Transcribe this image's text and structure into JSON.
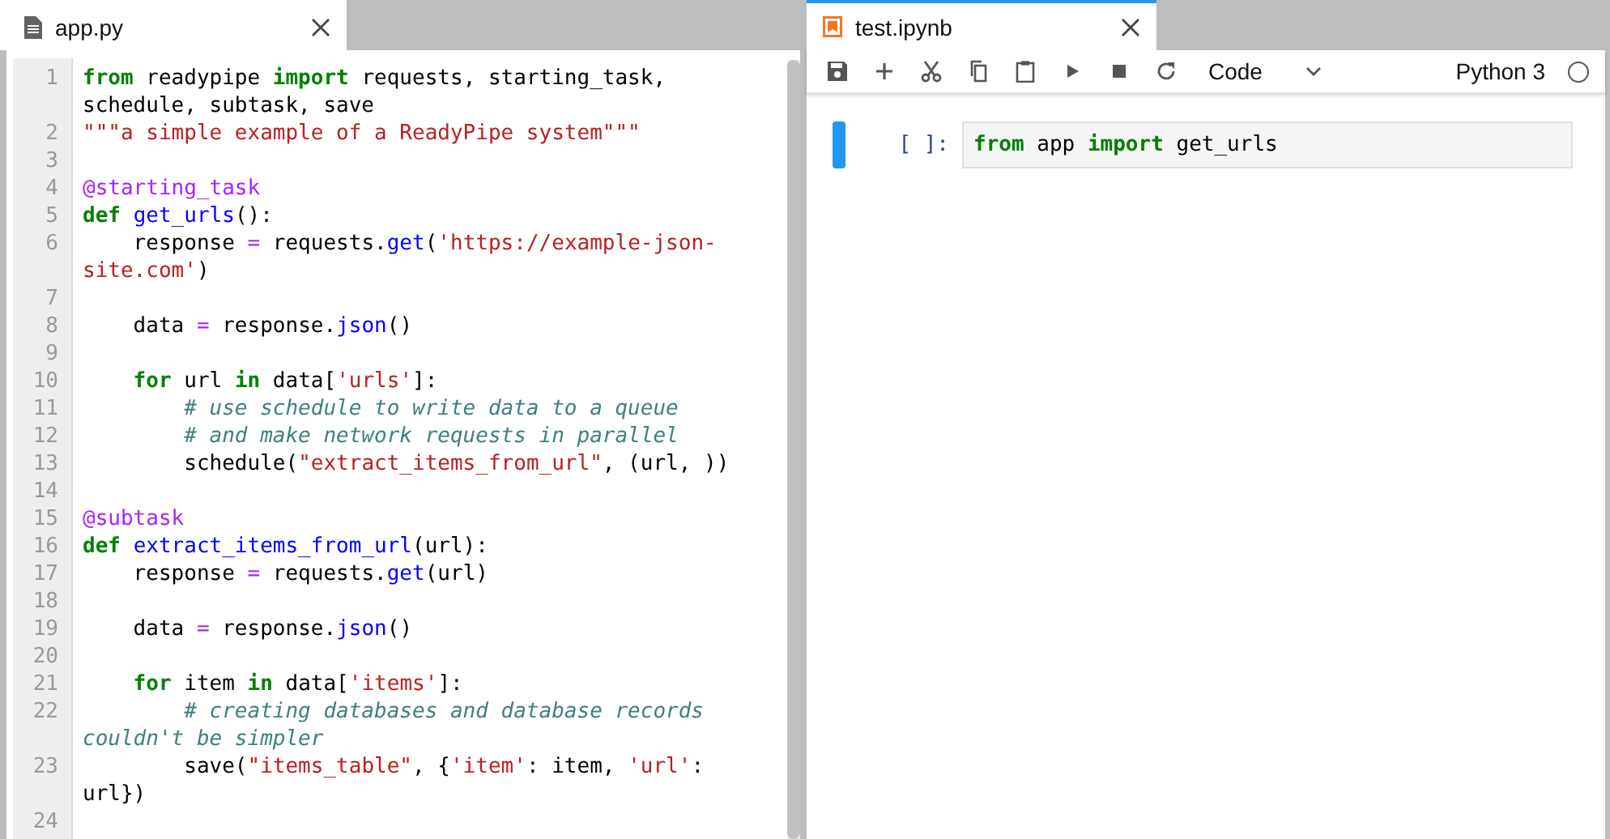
{
  "editor": {
    "tab": {
      "label": "app.py",
      "kind": "file"
    },
    "lines": [
      {
        "number": "1",
        "tokens": [
          {
            "kind": "kw",
            "text": "from"
          },
          {
            "kind": "plain",
            "text": " readypipe "
          },
          {
            "kind": "kw",
            "text": "import"
          },
          {
            "kind": "plain",
            "text": " requests, starting_task,"
          }
        ],
        "wrapped": [
          {
            "kind": "plain",
            "text": "schedule, subtask, save"
          }
        ]
      },
      {
        "number": "2",
        "tokens": [
          {
            "kind": "str",
            "text": "\"\"\"a simple example of a ReadyPipe system\"\"\""
          }
        ]
      },
      {
        "number": "3"
      },
      {
        "number": "4",
        "tokens": [
          {
            "kind": "deco",
            "text": "@starting_task"
          }
        ]
      },
      {
        "number": "5",
        "tokens": [
          {
            "kind": "kw",
            "text": "def "
          },
          {
            "kind": "def",
            "text": "get_urls"
          },
          {
            "kind": "plain",
            "text": "():"
          }
        ]
      },
      {
        "number": "6",
        "tokens": [
          {
            "kind": "plain",
            "text": "    response "
          },
          {
            "kind": "op",
            "text": "="
          },
          {
            "kind": "plain",
            "text": " requests."
          },
          {
            "kind": "prop",
            "text": "get"
          },
          {
            "kind": "plain",
            "text": "("
          },
          {
            "kind": "str",
            "text": "'https://example-json-"
          }
        ],
        "wrapped": [
          {
            "kind": "str",
            "text": "site.com'"
          },
          {
            "kind": "plain",
            "text": ")"
          }
        ]
      },
      {
        "number": "7"
      },
      {
        "number": "8",
        "tokens": [
          {
            "kind": "plain",
            "text": "    data "
          },
          {
            "kind": "op",
            "text": "="
          },
          {
            "kind": "plain",
            "text": " response."
          },
          {
            "kind": "prop",
            "text": "json"
          },
          {
            "kind": "plain",
            "text": "()"
          }
        ]
      },
      {
        "number": "9"
      },
      {
        "number": "10",
        "tokens": [
          {
            "kind": "kw",
            "text": "    for"
          },
          {
            "kind": "plain",
            "text": " url "
          },
          {
            "kind": "kw",
            "text": "in"
          },
          {
            "kind": "plain",
            "text": " data["
          },
          {
            "kind": "str",
            "text": "'urls'"
          },
          {
            "kind": "plain",
            "text": "]:"
          }
        ]
      },
      {
        "number": "11",
        "tokens": [
          {
            "kind": "comment",
            "text": "        # use schedule to write data to a queue"
          }
        ]
      },
      {
        "number": "12",
        "tokens": [
          {
            "kind": "comment",
            "text": "        # and make network requests in parallel"
          }
        ]
      },
      {
        "number": "13",
        "tokens": [
          {
            "kind": "plain",
            "text": "        schedule("
          },
          {
            "kind": "str",
            "text": "\"extract_items_from_url\""
          },
          {
            "kind": "plain",
            "text": ", (url, ))"
          }
        ]
      },
      {
        "number": "14"
      },
      {
        "number": "15",
        "tokens": [
          {
            "kind": "deco",
            "text": "@subtask"
          }
        ]
      },
      {
        "number": "16",
        "tokens": [
          {
            "kind": "kw",
            "text": "def "
          },
          {
            "kind": "def",
            "text": "extract_items_from_url"
          },
          {
            "kind": "plain",
            "text": "(url):"
          }
        ]
      },
      {
        "number": "17",
        "tokens": [
          {
            "kind": "plain",
            "text": "    response "
          },
          {
            "kind": "op",
            "text": "="
          },
          {
            "kind": "plain",
            "text": " requests."
          },
          {
            "kind": "prop",
            "text": "get"
          },
          {
            "kind": "plain",
            "text": "(url)"
          }
        ]
      },
      {
        "number": "18"
      },
      {
        "number": "19",
        "tokens": [
          {
            "kind": "plain",
            "text": "    data "
          },
          {
            "kind": "op",
            "text": "="
          },
          {
            "kind": "plain",
            "text": " response."
          },
          {
            "kind": "prop",
            "text": "json"
          },
          {
            "kind": "plain",
            "text": "()"
          }
        ]
      },
      {
        "number": "20"
      },
      {
        "number": "21",
        "tokens": [
          {
            "kind": "kw",
            "text": "    for"
          },
          {
            "kind": "plain",
            "text": " item "
          },
          {
            "kind": "kw",
            "text": "in"
          },
          {
            "kind": "plain",
            "text": " data["
          },
          {
            "kind": "str",
            "text": "'items'"
          },
          {
            "kind": "plain",
            "text": "]:"
          }
        ]
      },
      {
        "number": "22",
        "tokens": [
          {
            "kind": "comment",
            "text": "        # creating databases and database records"
          }
        ],
        "wrapped": [
          {
            "kind": "comment",
            "text": "couldn't be simpler"
          }
        ]
      },
      {
        "number": "23",
        "tokens": [
          {
            "kind": "plain",
            "text": "        save("
          },
          {
            "kind": "str",
            "text": "\"items_table\""
          },
          {
            "kind": "plain",
            "text": ", {"
          },
          {
            "kind": "str",
            "text": "'item'"
          },
          {
            "kind": "plain",
            "text": ": item, "
          },
          {
            "kind": "str",
            "text": "'url'"
          },
          {
            "kind": "plain",
            "text": ":"
          }
        ],
        "wrapped": [
          {
            "kind": "plain",
            "text": "url})"
          }
        ]
      },
      {
        "number": "24"
      }
    ]
  },
  "notebook": {
    "tab": {
      "label": "test.ipynb",
      "kind": "notebook"
    },
    "toolbar": [
      {
        "kind": "save"
      },
      {
        "kind": "add"
      },
      {
        "kind": "cut"
      },
      {
        "kind": "copy"
      },
      {
        "kind": "paste"
      },
      {
        "kind": "run"
      },
      {
        "kind": "stop"
      },
      {
        "kind": "restart"
      }
    ],
    "cell_type": "Code",
    "kernel": {
      "name": "Python 3",
      "busy": false
    },
    "cells": [
      {
        "prompt": "[ ]:",
        "active": true,
        "tokens": [
          {
            "kind": "kw",
            "text": "from"
          },
          {
            "kind": "plain",
            "text": " app "
          },
          {
            "kind": "kw",
            "text": "import"
          },
          {
            "kind": "plain",
            "text": " get_urls"
          }
        ]
      }
    ]
  }
}
